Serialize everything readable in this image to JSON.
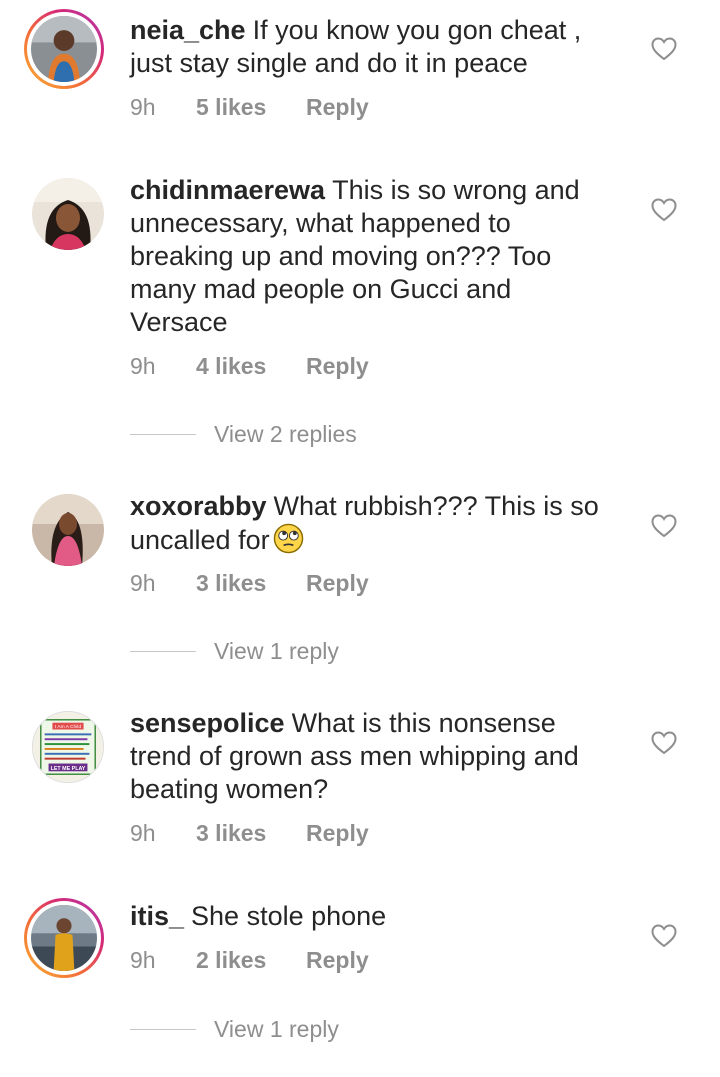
{
  "comments": [
    {
      "username": "neia_che",
      "text": "If you know you gon cheat , just stay single and do it in peace",
      "time": "9h",
      "likes": "5 likes",
      "reply": "Reply",
      "view_replies": ""
    },
    {
      "username": "chidinmaerewa",
      "text": "This is so wrong and unnecessary, what happened to breaking up and moving on??? Too many mad people on Gucci and Versace",
      "time": "9h",
      "likes": "4 likes",
      "reply": "Reply",
      "view_replies": "View 2 replies"
    },
    {
      "username": "xoxorabby",
      "text": "What rubbish??? This is so uncalled for",
      "emoji": "face-with-rolling-eyes",
      "time": "9h",
      "likes": "3 likes",
      "reply": "Reply",
      "view_replies": "View 1 reply"
    },
    {
      "username": "sensepolice",
      "text": "What is this nonsense trend of grown ass men whipping and beating women?",
      "avatar_text": [
        "I Am A Child",
        "LET ME PLAY"
      ],
      "time": "9h",
      "likes": "3 likes",
      "reply": "Reply",
      "view_replies": ""
    },
    {
      "username": "itis_",
      "text": "She stole phone",
      "time": "9h",
      "likes": "2 likes",
      "reply": "Reply",
      "view_replies": "View 1 reply"
    }
  ],
  "icons": {
    "like": "heart-outline-icon"
  },
  "colors": {
    "text": "#262626",
    "secondary": "#8e8e8e",
    "story_ring": "#d62976"
  }
}
